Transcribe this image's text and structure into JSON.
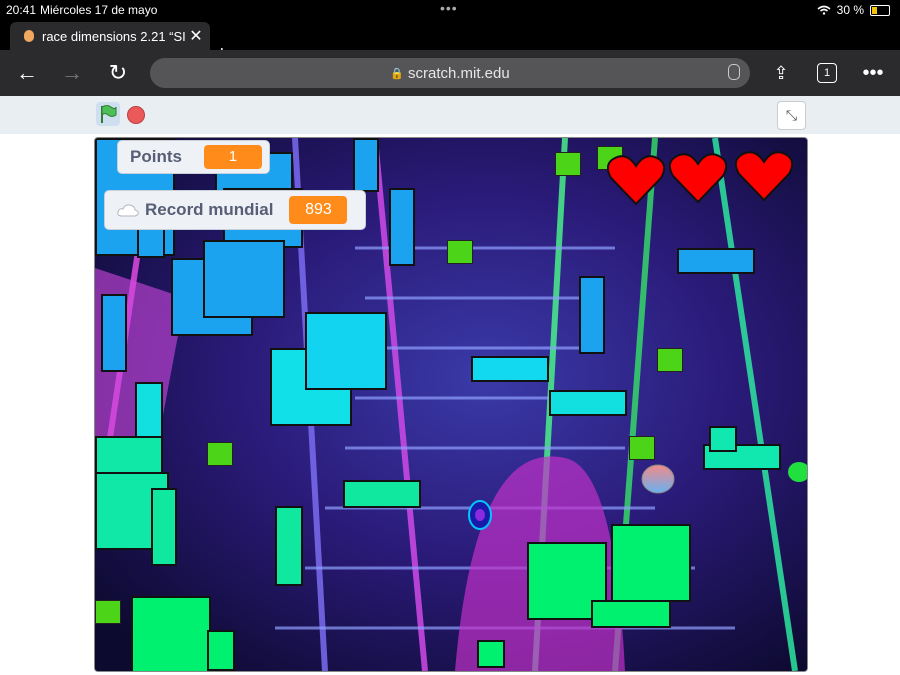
{
  "status_bar": {
    "time": "20:41",
    "date": "Miércoles 17 de mayo",
    "battery": "30 %",
    "battery_level": 0.3
  },
  "tab": {
    "title": "race dimensions 2.21 “SI",
    "close_icon": "close-icon",
    "new_tab_icon": "plus-icon"
  },
  "toolbar": {
    "url": "scratch.mit.edu",
    "tab_count": "1"
  },
  "scratch": {
    "points_label": "Points",
    "points_value": "1",
    "record_label": "Record mundial",
    "record_value": "893",
    "lives": 3
  },
  "colors": {
    "accent": "#ff8c1a",
    "heart": "#ff0000",
    "stage_cyan": "#00e5ff",
    "stage_green": "#00f070",
    "stage_blue": "#1ba3f0"
  }
}
